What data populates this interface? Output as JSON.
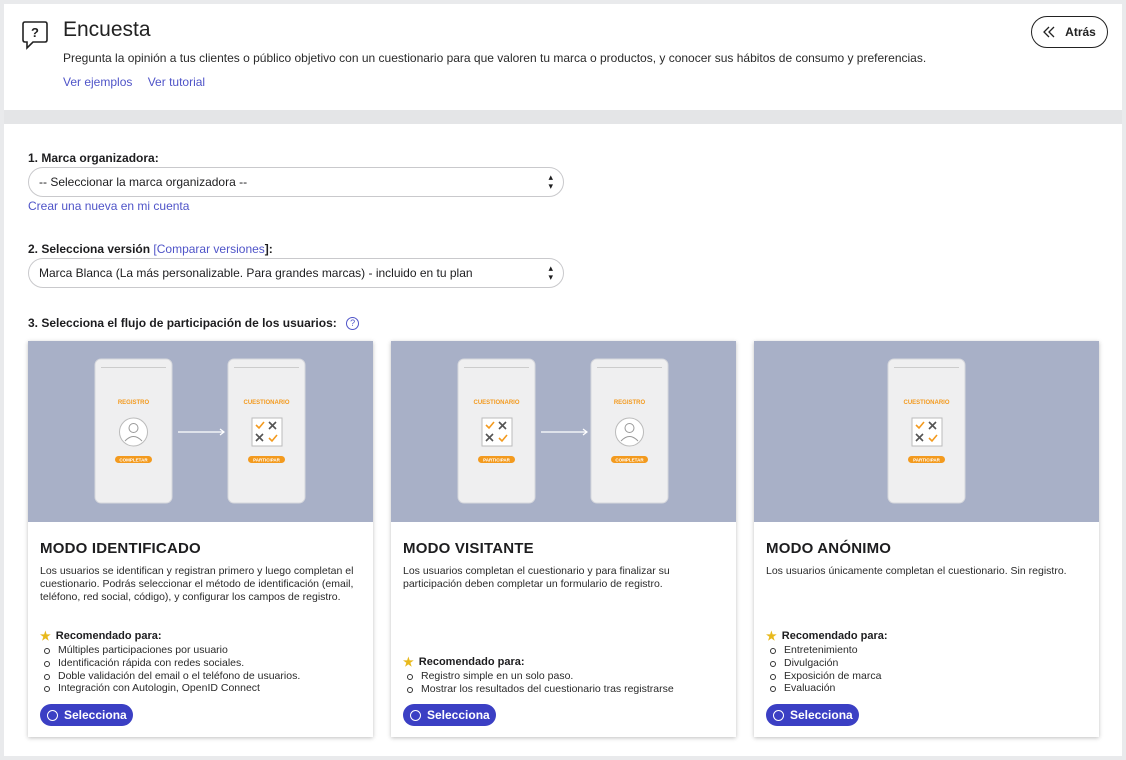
{
  "header": {
    "title": "Encuesta",
    "description": "Pregunta la opinión a tus clientes o público objetivo con un cuestionario para que valoren tu marca o productos, y conocer sus hábitos de consumo y preferencias.",
    "link_examples": "Ver ejemplos",
    "link_tutorial": "Ver tutorial",
    "back_label": "Atrás"
  },
  "step1": {
    "label": "1. Marca organizadora:",
    "select_value": "-- Seleccionar la marca organizadora --",
    "create_link": "Crear una nueva en mi cuenta"
  },
  "step2": {
    "label": "2. Selecciona versión",
    "compare_open": "[",
    "compare_link": "Comparar versiones",
    "compare_close": "]:",
    "select_value": "Marca Blanca (La más personalizable. Para grandes marcas) - incluido en tu plan"
  },
  "step3": {
    "label": "3. Selecciona el flujo de participación de los usuarios:",
    "help": "?"
  },
  "phone_labels": {
    "registro": "REGISTRO",
    "cuestionario": "CUESTIONARIO",
    "completar": "COMPLETAR",
    "participar": "PARTICIPAR"
  },
  "cards": [
    {
      "title": "MODO IDENTIFICADO",
      "description": "Los usuarios se identifican y registran primero y luego completan el cuestionario. Podrás seleccionar el método de identificación (email, teléfono, red social, código), y configurar los campos de registro.",
      "rec_title": "Recomendado para:",
      "items": [
        "Múltiples participaciones por usuario",
        "Identificación rápida con redes sociales.",
        "Doble validación del email o el teléfono de usuarios.",
        "Integración con Autologin, OpenID Connect"
      ],
      "button": "Selecciona"
    },
    {
      "title": "MODO VISITANTE",
      "description": "Los usuarios completan el cuestionario y para finalizar su participación deben completar un formulario de registro.",
      "rec_title": "Recomendado para:",
      "items": [
        "Registro simple en un solo paso.",
        "Mostrar los resultados del cuestionario tras registrarse"
      ],
      "button": "Selecciona"
    },
    {
      "title": "MODO ANÓNIMO",
      "description": "Los usuarios únicamente completan el cuestionario. Sin registro.",
      "rec_title": "Recomendado para:",
      "items": [
        "Entretenimiento",
        "Divulgación",
        "Exposición de marca",
        "Evaluación"
      ],
      "button": "Selecciona"
    }
  ],
  "colors": {
    "accent": "#3b3fc4",
    "link": "#4f54c8",
    "illustration_bg": "#a8b0c7",
    "orange": "#f39a1e",
    "star": "#e8b91c"
  }
}
